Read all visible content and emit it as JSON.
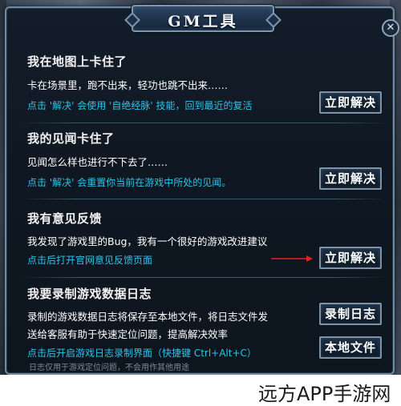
{
  "dialog": {
    "title": "GM工具",
    "close_symbol": "✕"
  },
  "sections": [
    {
      "title": "我在地图上卡住了",
      "description": "卡在场景里，跑不出来，轻功也跳不出来……",
      "hint": "点击 '解决' 会使用 '自绝经脉' 技能，回到最近的复活",
      "button": "立即解决"
    },
    {
      "title": "我的见闻卡住了",
      "description": "见闻怎么样也进行不下去了……",
      "hint": "点击 '解决' 会重置你当前在游戏中所处的见闻。",
      "button": "立即解决"
    },
    {
      "title": "我有意见反馈",
      "description": "我发现了游戏里的Bug，我有一个很好的游戏改进建议",
      "hint": "点击后打开官网意见反馈页面",
      "button": "立即解决"
    },
    {
      "title": "我要录制游戏数据日志",
      "description_line1": "录制的游戏数据日志将保存至本地文件，将日志文件发",
      "description_line2": "送给客服有助于快速定位问题，提高解决效率",
      "hint": "点击后开启游戏日志录制界面（快捷键 Ctrl+Alt+C）",
      "button_record": "录制日志",
      "button_file": "本地文件"
    }
  ],
  "footnote": "日志仅用于游戏定位问题，不会用作其他用途",
  "watermark": "远方APP手游网",
  "colors": {
    "hint": "#2fc3e6",
    "arrow": "#e02020",
    "panel": "#0f1822",
    "border": "#6f8aa4"
  }
}
